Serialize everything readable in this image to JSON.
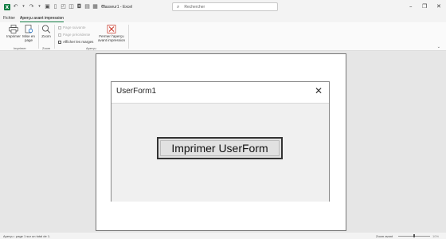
{
  "titlebar": {
    "app_logo": "X",
    "doc_title": "Classeur1 - Excel",
    "search_placeholder": "Rechercher",
    "controls": {
      "minimize": "–",
      "restore": "❐",
      "close": "✕"
    }
  },
  "tabs": [
    {
      "label": "Fichier",
      "active": false
    },
    {
      "label": "Aperçu avant impression",
      "active": true
    }
  ],
  "ribbon": {
    "print_label": "Imprimer",
    "page_setup_label": "Mise en page",
    "zoom_label": "Zoom",
    "next_page_label": "Page suivante",
    "prev_page_label": "Page précédente",
    "show_margins_label": "Afficher les marges",
    "close_preview_label": "Fermer l'aperçu avant impression",
    "groups": {
      "print": "Imprimer",
      "zoom": "Zoom",
      "preview": "Aperçu"
    }
  },
  "userform": {
    "title": "UserForm1",
    "button_label": "Imprimer UserForm"
  },
  "statusbar": {
    "page_info": "Aperçu : page 1 sur un total de 1.",
    "zoom_label": "Zoom avant",
    "zoom_value": "10%"
  },
  "colors": {
    "accent": "#107c41",
    "close_icon": "#c42b1c"
  }
}
